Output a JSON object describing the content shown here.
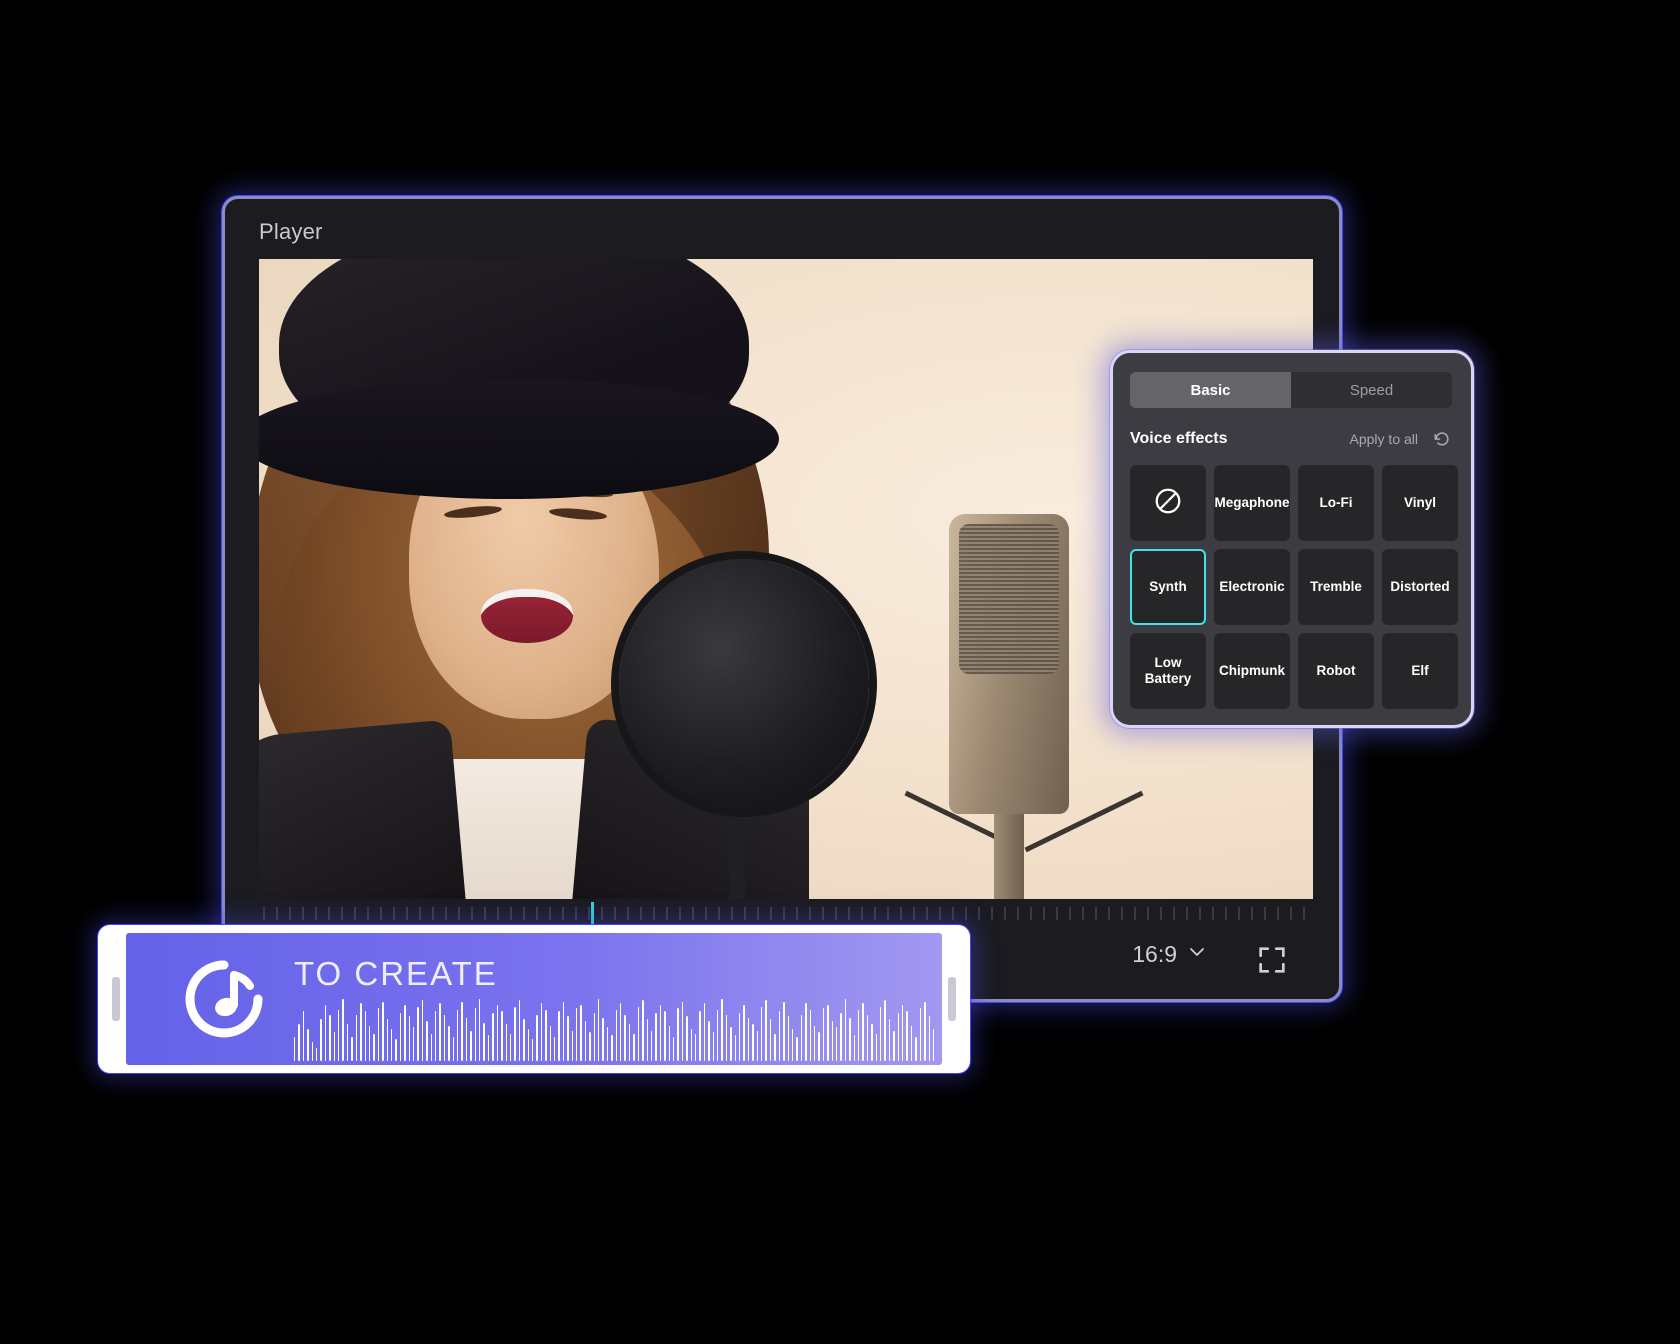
{
  "player": {
    "title": "Player",
    "aspect_ratio": "16:9",
    "chevron_icon": "chevron-down-icon",
    "fullscreen_icon": "fullscreen-icon",
    "playhead_position_pct": 31.5
  },
  "fx_panel": {
    "tabs": [
      {
        "label": "Basic",
        "active": true
      },
      {
        "label": "Speed",
        "active": false
      }
    ],
    "section_title": "Voice effects",
    "apply_to_all": "Apply to all",
    "reset_icon": "reset-icon",
    "effects": [
      {
        "label": "",
        "icon": "none-forbidden-icon",
        "selected": false
      },
      {
        "label": "Megaphone",
        "selected": false
      },
      {
        "label": "Lo-Fi",
        "selected": false
      },
      {
        "label": "Vinyl",
        "selected": false
      },
      {
        "label": "Synth",
        "selected": true
      },
      {
        "label": "Electronic",
        "selected": false
      },
      {
        "label": "Tremble",
        "selected": false
      },
      {
        "label": "Distorted",
        "selected": false
      },
      {
        "label": "Low Battery",
        "selected": false
      },
      {
        "label": "Chipmunk",
        "selected": false
      },
      {
        "label": "Robot",
        "selected": false
      },
      {
        "label": "Elf",
        "selected": false
      }
    ]
  },
  "audio_clip": {
    "label": "TO CREATE",
    "icon": "music-note-icon",
    "left_handle": "trim-handle-left",
    "right_handle": "trim-handle-right",
    "waveform_levels": [
      30,
      46,
      62,
      40,
      24,
      16,
      52,
      70,
      58,
      36,
      64,
      78,
      46,
      30,
      58,
      72,
      62,
      44,
      34,
      66,
      74,
      52,
      40,
      28,
      60,
      70,
      56,
      42,
      68,
      76,
      50,
      34,
      62,
      72,
      58,
      44,
      30,
      64,
      74,
      54,
      38,
      66,
      78,
      48,
      32,
      60,
      70,
      62,
      46,
      34,
      68,
      76,
      52,
      40,
      28,
      58,
      72,
      64,
      44,
      30,
      62,
      74,
      56,
      38,
      66,
      70,
      50,
      36,
      60,
      78,
      54,
      42,
      32,
      64,
      72,
      58,
      46,
      34,
      68,
      76,
      52,
      38,
      60,
      70,
      62,
      44,
      30,
      66,
      74,
      56,
      40,
      34,
      62,
      72,
      50,
      36,
      64,
      78,
      58,
      42,
      32,
      60,
      70,
      54,
      46,
      38,
      68,
      76,
      52,
      34,
      62,
      74,
      56,
      40,
      30,
      58,
      72,
      64,
      44,
      36,
      66,
      70,
      50,
      42,
      60,
      78,
      54,
      32,
      64,
      72,
      58,
      46,
      34,
      68,
      76,
      52,
      38,
      60,
      70,
      62,
      44,
      30,
      66,
      74,
      56,
      40
    ]
  },
  "colors": {
    "accent_purple": "#6462e8",
    "selection_cyan": "#3fe3ea",
    "panel_bg": "#3c3c42",
    "window_bg": "#1b1b20",
    "glow_blue": "#4242ff"
  }
}
